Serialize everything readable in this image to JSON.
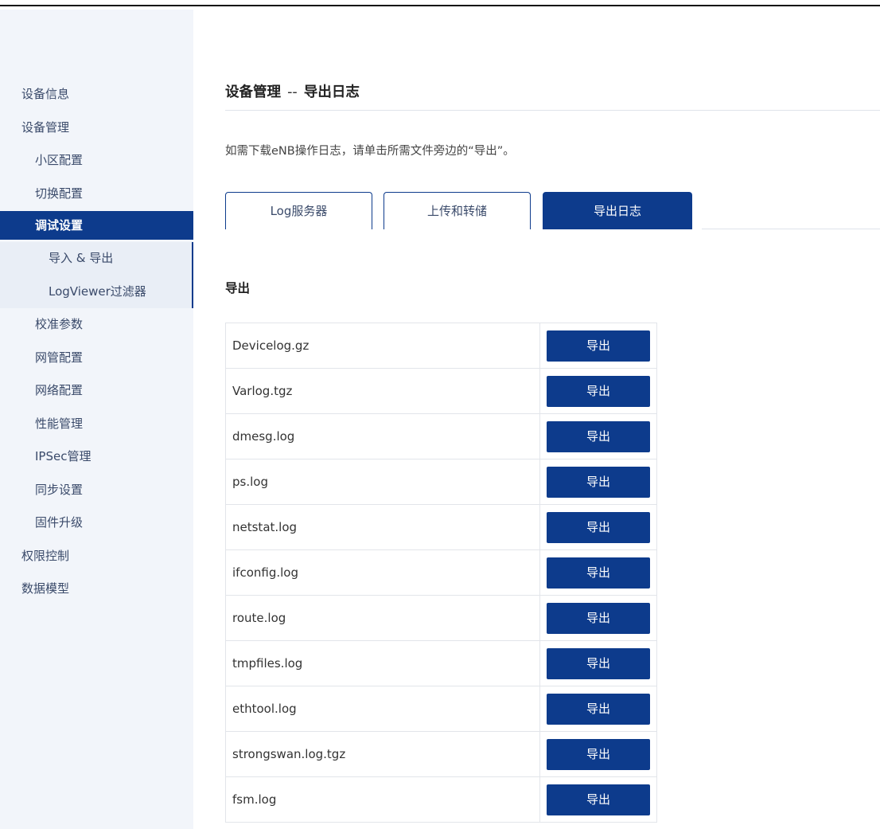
{
  "sidebar": {
    "items": [
      {
        "label": "设备信息"
      },
      {
        "label": "设备管理"
      },
      {
        "label": "小区配置"
      },
      {
        "label": "切换配置"
      },
      {
        "label": "调试设置"
      },
      {
        "label": "导入 & 导出"
      },
      {
        "label": "LogViewer过滤器"
      },
      {
        "label": "校准参数"
      },
      {
        "label": "网管配置"
      },
      {
        "label": "网络配置"
      },
      {
        "label": "性能管理"
      },
      {
        "label": "IPSec管理"
      },
      {
        "label": "同步设置"
      },
      {
        "label": "固件升级"
      },
      {
        "label": "权限控制"
      },
      {
        "label": "数据模型"
      }
    ]
  },
  "page": {
    "title_main": "设备管理",
    "title_sep": "--",
    "title_sub": "导出日志",
    "intro": "如需下载eNB操作日志，请单击所需文件旁边的“导出”。"
  },
  "tabs": [
    {
      "label": "Log服务器"
    },
    {
      "label": "上传和转储"
    },
    {
      "label": "导出日志"
    }
  ],
  "export": {
    "section_title": "导出",
    "button_label": "导出",
    "files": [
      {
        "name": "Devicelog.gz"
      },
      {
        "name": "Varlog.tgz"
      },
      {
        "name": "dmesg.log"
      },
      {
        "name": "ps.log"
      },
      {
        "name": "netstat.log"
      },
      {
        "name": "ifconfig.log"
      },
      {
        "name": "route.log"
      },
      {
        "name": "tmpfiles.log"
      },
      {
        "name": "ethtool.log"
      },
      {
        "name": "strongswan.log.tgz"
      },
      {
        "name": "fsm.log"
      }
    ]
  },
  "colors": {
    "accent": "#0d3b8c",
    "sidebar_bg": "#f2f5fa"
  }
}
